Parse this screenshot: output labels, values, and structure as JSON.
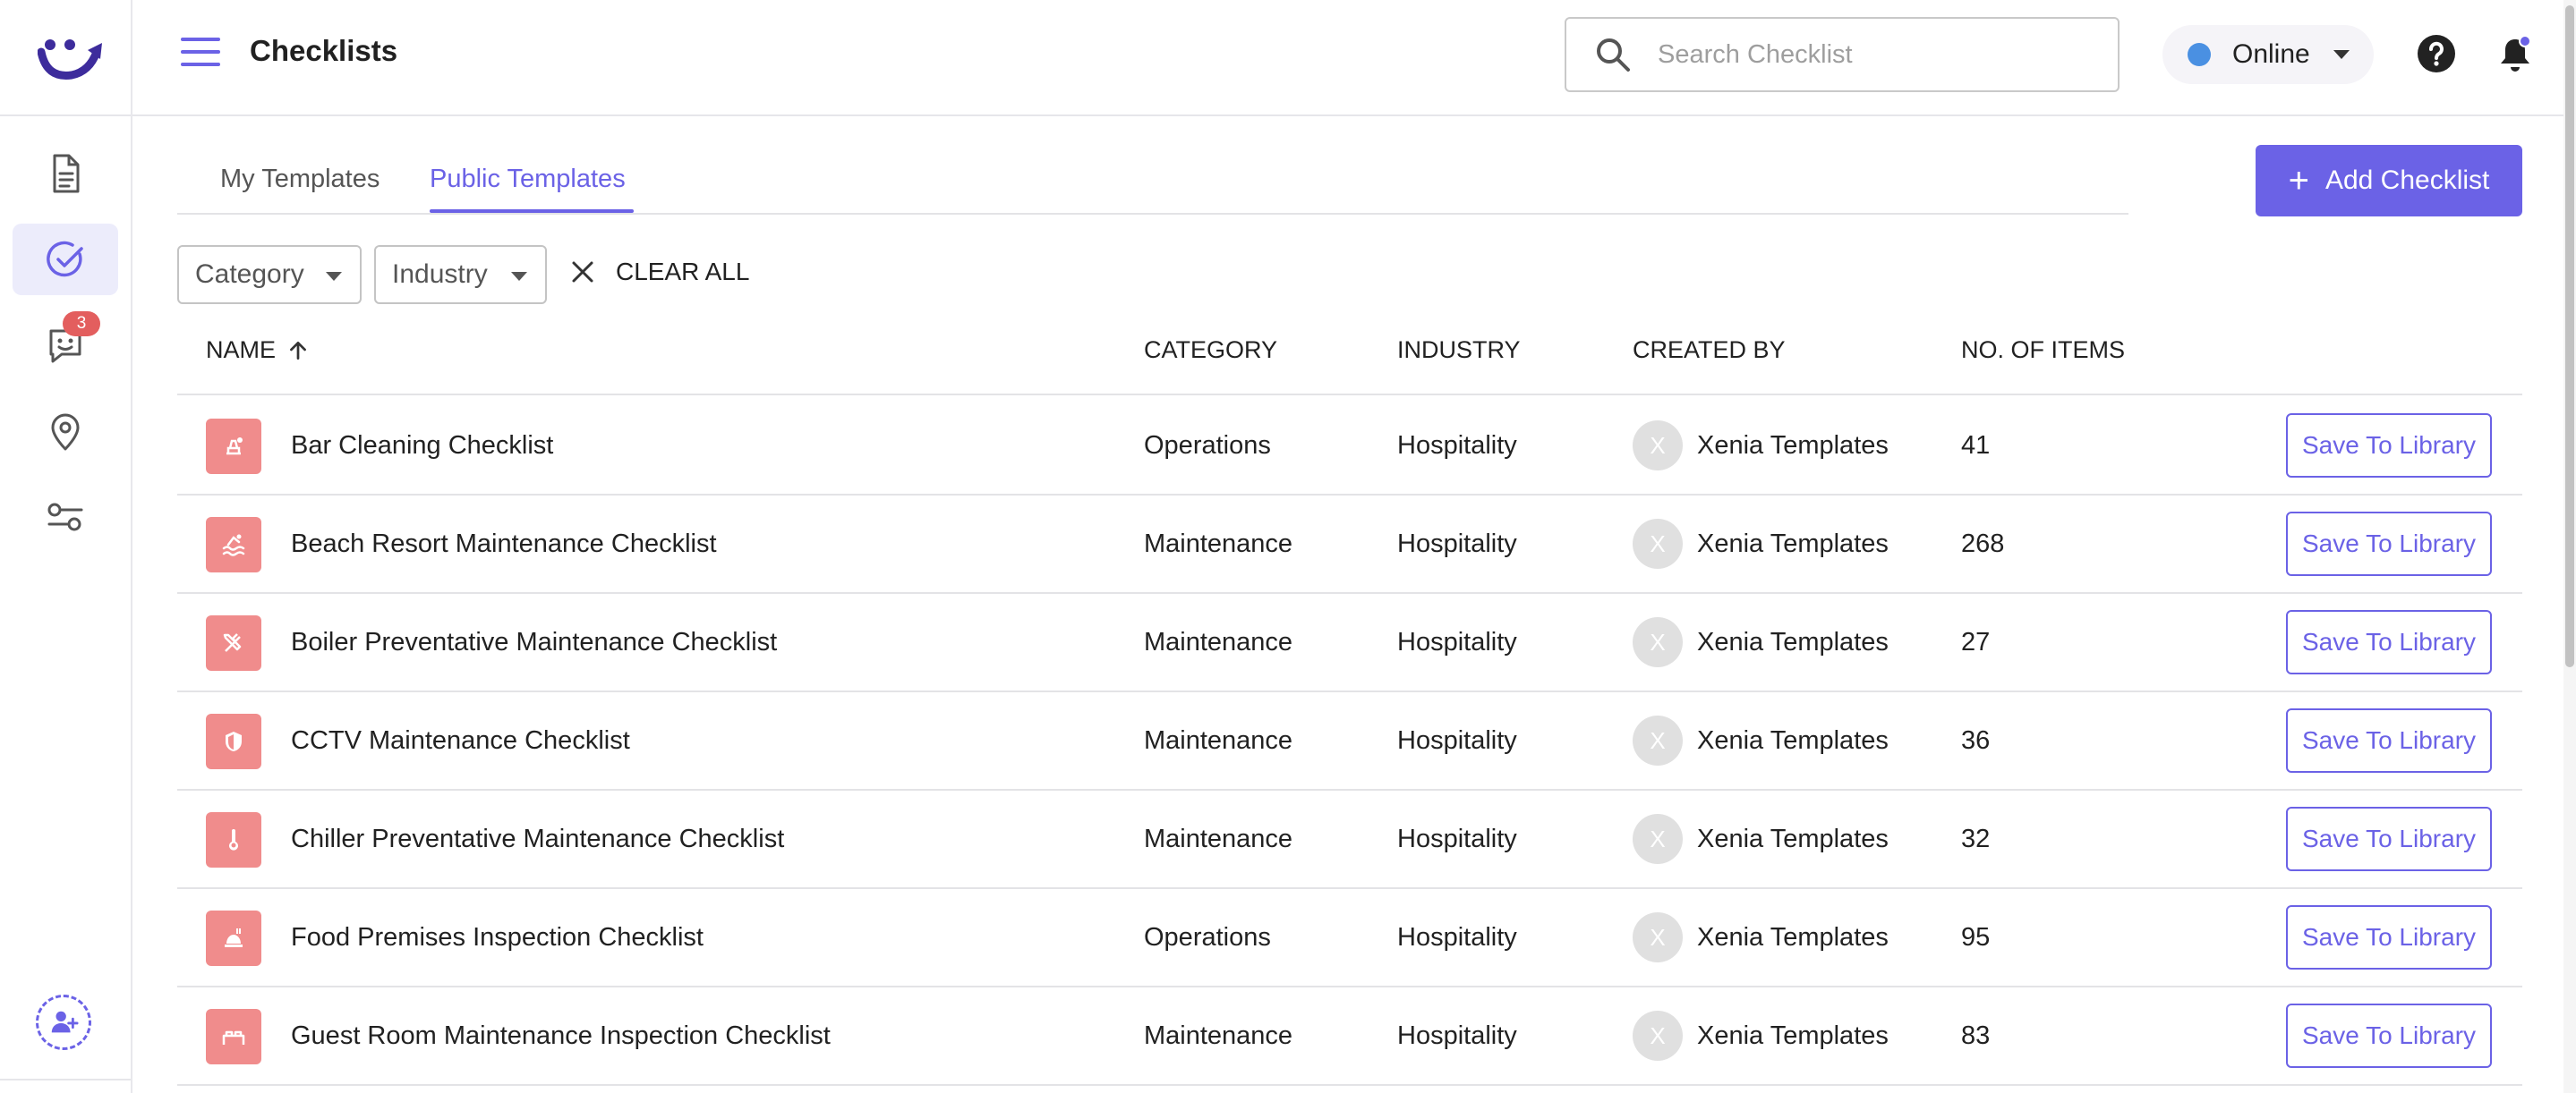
{
  "header": {
    "title": "Checklists",
    "search_placeholder": "Search Checklist",
    "status_label": "Online"
  },
  "sidebar": {
    "items": [
      {
        "icon": "document-icon"
      },
      {
        "icon": "checklist-check-icon",
        "active": true
      },
      {
        "icon": "chat-icon",
        "badge": "3"
      },
      {
        "icon": "location-pin-icon"
      },
      {
        "icon": "settings-sliders-icon"
      }
    ]
  },
  "tabs": [
    {
      "label": "My Templates"
    },
    {
      "label": "Public Templates",
      "active": true
    }
  ],
  "add_button": "Add Checklist",
  "filters": {
    "category": "Category",
    "industry": "Industry",
    "clear_all": "CLEAR ALL"
  },
  "table": {
    "headers": {
      "name": "NAME",
      "category": "CATEGORY",
      "industry": "INDUSTRY",
      "created_by": "CREATED BY",
      "items": "NO. OF ITEMS"
    },
    "rows": [
      {
        "icon": "bar-cleaning-icon",
        "name": "Bar Cleaning Checklist",
        "category": "Operations",
        "industry": "Hospitality",
        "avatar": "X",
        "created_by": "Xenia Templates",
        "items": "41",
        "action": "Save To Library"
      },
      {
        "icon": "pool-icon",
        "name": "Beach Resort Maintenance Checklist",
        "category": "Maintenance",
        "industry": "Hospitality",
        "avatar": "X",
        "created_by": "Xenia Templates",
        "items": "268",
        "action": "Save To Library"
      },
      {
        "icon": "tools-icon",
        "name": "Boiler Preventative Maintenance Checklist",
        "category": "Maintenance",
        "industry": "Hospitality",
        "avatar": "X",
        "created_by": "Xenia Templates",
        "items": "27",
        "action": "Save To Library"
      },
      {
        "icon": "shield-icon",
        "name": "CCTV Maintenance Checklist",
        "category": "Maintenance",
        "industry": "Hospitality",
        "avatar": "X",
        "created_by": "Xenia Templates",
        "items": "36",
        "action": "Save To Library"
      },
      {
        "icon": "thermometer-icon",
        "name": "Chiller Preventative Maintenance Checklist",
        "category": "Maintenance",
        "industry": "Hospitality",
        "avatar": "X",
        "created_by": "Xenia Templates",
        "items": "32",
        "action": "Save To Library"
      },
      {
        "icon": "food-icon",
        "name": "Food Premises Inspection Checklist",
        "category": "Operations",
        "industry": "Hospitality",
        "avatar": "X",
        "created_by": "Xenia Templates",
        "items": "95",
        "action": "Save To Library"
      },
      {
        "icon": "bed-icon",
        "name": "Guest Room Maintenance Inspection Checklist",
        "category": "Maintenance",
        "industry": "Hospitality",
        "avatar": "X",
        "created_by": "Xenia Templates",
        "items": "83",
        "action": "Save To Library"
      }
    ]
  },
  "colors": {
    "accent": "#6b62e6",
    "row_icon_bg": "#f08c8c",
    "badge": "#e35e5e",
    "online_dot": "#4a90e2"
  }
}
